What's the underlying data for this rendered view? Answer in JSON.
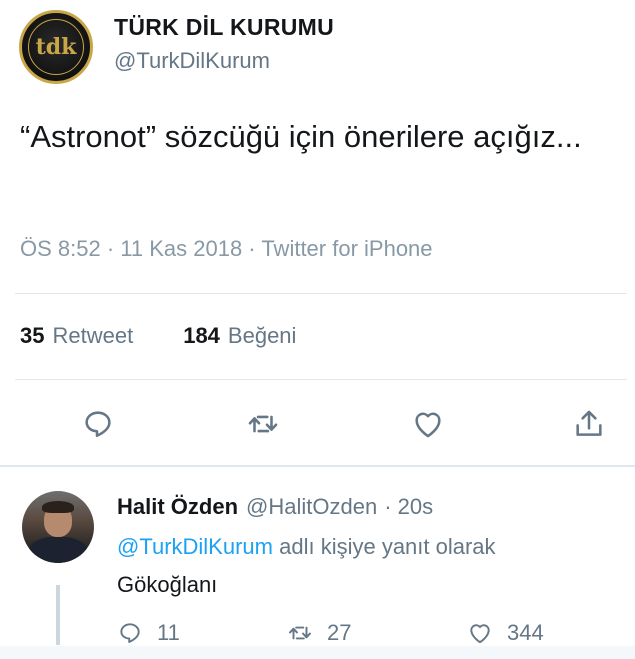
{
  "tweet": {
    "author_name": "TÜRK DİL KURUMU",
    "author_handle": "@TurkDilKurum",
    "avatar_text": "tdk",
    "text": "“Astronot” sözcüğü için önerilere açığız...",
    "meta": "ÖS 8:52 · 11 Kas 2018 · Twitter for iPhone",
    "retweets": {
      "count": "35",
      "label": "Retweet"
    },
    "likes": {
      "count": "184",
      "label": "Beğeni"
    },
    "actions": [
      {
        "name": "reply",
        "icon": "reply-icon"
      },
      {
        "name": "retweet",
        "icon": "retweet-icon"
      },
      {
        "name": "like",
        "icon": "heart-icon"
      },
      {
        "name": "share",
        "icon": "share-icon"
      }
    ]
  },
  "reply": {
    "author_name": "Halit Özden",
    "author_handle": "@HalitOzden",
    "time": "· 20s",
    "reply_to_mention": "@TurkDilKurum",
    "reply_to_suffix": "adlı kişiye yanıt olarak",
    "text": "Gökoğlanı",
    "replies": "11",
    "retweets": "27",
    "likes": "344"
  },
  "colors": {
    "link": "#1da1f2",
    "secondary_text": "#657786",
    "divider": "#e1e8ed",
    "gold": "#c9a646"
  }
}
